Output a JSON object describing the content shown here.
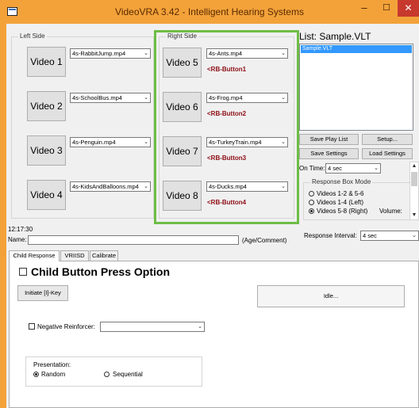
{
  "window": {
    "title": "VideoVRA 3.42 - Intelligent Hearing Systems",
    "minimize_glyph": "–",
    "maximize_glyph": "☐",
    "close_glyph": "✕",
    "accent_color": "#f3a23a"
  },
  "left_side": {
    "label": "Left Side",
    "rows": [
      {
        "button": "Video 1",
        "file": "4s-RabbitJump.mp4"
      },
      {
        "button": "Video 2",
        "file": "4s-SchoolBus.mp4"
      },
      {
        "button": "Video 3",
        "file": "4s-Penguin.mp4"
      },
      {
        "button": "Video 4",
        "file": "4s-KidsAndBalloons.mp4"
      }
    ]
  },
  "right_side": {
    "label": "Right Side",
    "highlight_color": "#6dbd45",
    "rows": [
      {
        "button": "Video 5",
        "file": "4s-Ants.mp4",
        "rb": "<RB-Button1"
      },
      {
        "button": "Video 6",
        "file": "4s-Frog.mp4",
        "rb": "<RB-Button2"
      },
      {
        "button": "Video 7",
        "file": "4s-TurkeyTrain.mp4",
        "rb": "<RB-Button3"
      },
      {
        "button": "Video 8",
        "file": "4s-Ducks.mp4",
        "rb": "<RB-Button4"
      }
    ]
  },
  "playlist": {
    "title": "List: Sample.VLT",
    "items": [
      "Sample.VLT"
    ],
    "selected_color": "#3399ff",
    "save_play_list": "Save Play List",
    "setup": "Setup...",
    "save_settings": "Save Settings",
    "load_settings": "Load Settings"
  },
  "on_time": {
    "label": "On Time:",
    "value": "4 sec"
  },
  "response_box_mode": {
    "label": "Response Box Mode",
    "options": [
      "Videos 1-2 & 5-6",
      "Videos 1-4 (Left)",
      "Videos 5-8 (Right)"
    ],
    "selected": "Videos 5-8 (Right)"
  },
  "volume": {
    "label": "Volume:"
  },
  "time": "12:17:30",
  "name": {
    "label": "Name:",
    "value": "",
    "hint": "(Age/Comment)"
  },
  "response_interval": {
    "label": "Response Interval:",
    "value": "4 sec"
  },
  "tabs": [
    {
      "label": "Child Response",
      "active": true
    },
    {
      "label": "VRIISD",
      "active": false
    },
    {
      "label": "Calibrate",
      "active": false
    }
  ],
  "child_response": {
    "option_label": "Child Button Press Option",
    "initiate_button": "Initiate [I]-Key",
    "status": "Idle...",
    "negative_reinforcer_label": "Negative Reinforcer:",
    "negative_reinforcer_value": "",
    "presentation": {
      "label": "Presentation:",
      "random": "Random",
      "sequential": "Sequential",
      "selected": "Random"
    }
  },
  "icons": {
    "app": "app-window-icon",
    "dropdown": "chevron-down-icon",
    "scroll_up": "scroll-up-icon",
    "scroll_down": "scroll-down-icon"
  }
}
